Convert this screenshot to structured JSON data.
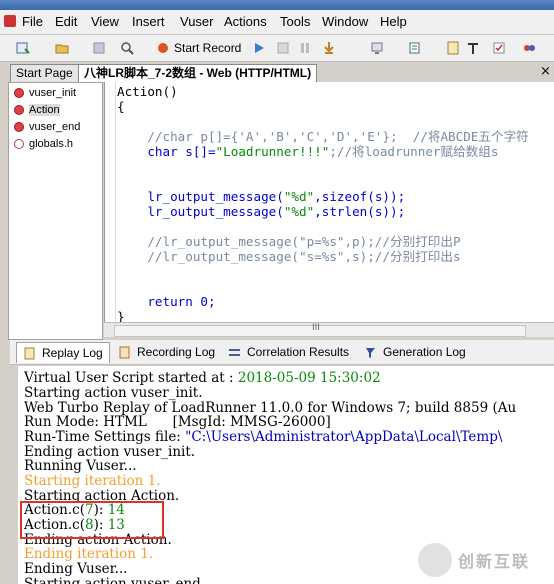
{
  "menu": [
    "File",
    "Edit",
    "View",
    "Insert",
    "Vuser",
    "Actions",
    "Tools",
    "Window",
    "Help"
  ],
  "toolbar": {
    "start_record_label": "Start Record"
  },
  "tabs": {
    "start_page": "Start Page",
    "script": "八神LR脚本_7-2数组 - Web (HTTP/HTML)",
    "close": "×"
  },
  "tree": [
    "vuser_init",
    "Action",
    "vuser_end",
    "globals.h"
  ],
  "code": {
    "l1": "Action()",
    "l2": "{",
    "l3": "//char p[]={'A','B','C','D','E'};  //将ABCDE五个字符",
    "l4a": "char s[]=",
    "l4b": "\"Loadrunner!!!\"",
    "l4c": ";//将loadrunner赋给数组s",
    "l5a": "lr_output_message(",
    "l5b": "\"%d\"",
    "l5c": ",",
    "l5d": "sizeof",
    "l5e": "(s));",
    "l6a": "lr_output_message(",
    "l6b": "\"%d\"",
    "l6c": ",strlen(s));",
    "l7": "//lr_output_message(\"p=%s\",p);//分别打印出P",
    "l8": "//lr_output_message(\"s=%s\",s);//分别打印出s",
    "l9a": "return",
    "l9b": " 0;",
    "l10": "}"
  },
  "scrollbar_grip": "III",
  "logtabs": [
    "Replay Log",
    "Recording Log",
    "Correlation Results",
    "Generation Log"
  ],
  "log": {
    "l1a": "Virtual User Script started at : ",
    "l1b": "2018-05-09 15:30:02",
    "l2": "Starting action vuser_init.",
    "l3": "Web Turbo Replay of LoadRunner 11.0.0 for Windows 7; build 8859 (Au",
    "l4": "Run Mode: HTML      [MsgId: MMSG-26000]",
    "l5a": "Run-Time Settings file: ",
    "l5b": "\"C:\\Users\\Administrator\\AppData\\Local\\Temp\\",
    "l6": "Ending action vuser_init.",
    "l7": "Running Vuser...",
    "l8": "Starting iteration 1.",
    "l9": "Starting action Action.",
    "l10a": "Action.c(",
    "l10b": "7",
    "l10c": "): ",
    "l10d": "14",
    "l11a": "Action.c(",
    "l11b": "8",
    "l11c": "): ",
    "l11d": "13",
    "l12": "Ending action Action.",
    "l13": "Ending iteration 1.",
    "l14": "Ending Vuser...",
    "l15": "Starting action vuser_end."
  },
  "watermark": {
    "text": "创新互联"
  },
  "colors": {
    "highlight_box": "#e0302a",
    "orange_log": "#f0a030",
    "timestamp": "#0a8a0a"
  }
}
